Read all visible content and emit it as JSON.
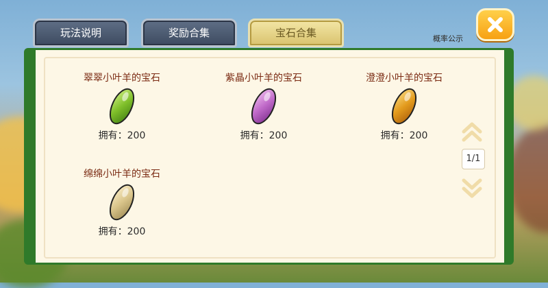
{
  "tabs": [
    {
      "label": "玩法说明",
      "active": false
    },
    {
      "label": "奖励合集",
      "active": false
    },
    {
      "label": "宝石合集",
      "active": true
    }
  ],
  "close_icon": "close-icon",
  "probability_link": "概率公示",
  "items": [
    {
      "name": "翠翠小叶羊的宝石",
      "count": "拥有：200",
      "gem_color": "#7fbf2a"
    },
    {
      "name": "紫晶小叶羊的宝石",
      "count": "拥有：200",
      "gem_color": "#c06ac9"
    },
    {
      "name": "澄澄小叶羊的宝石",
      "count": "拥有：200",
      "gem_color": "#e39b1d"
    },
    {
      "name": "绵绵小叶羊的宝石",
      "count": "拥有：200",
      "gem_color": "#d9c48a"
    }
  ],
  "pager": {
    "page_text": "1/1",
    "up_icon": "double-chevron-up-icon",
    "down_icon": "double-chevron-down-icon"
  },
  "colors": {
    "panel_bg": "#fdf7e6",
    "frame_green": "#2f7a2a",
    "tab_active": "#e6d48a",
    "tab_inactive": "#4a5870",
    "close_button": "#f8b021",
    "item_name": "#7a2a12"
  }
}
